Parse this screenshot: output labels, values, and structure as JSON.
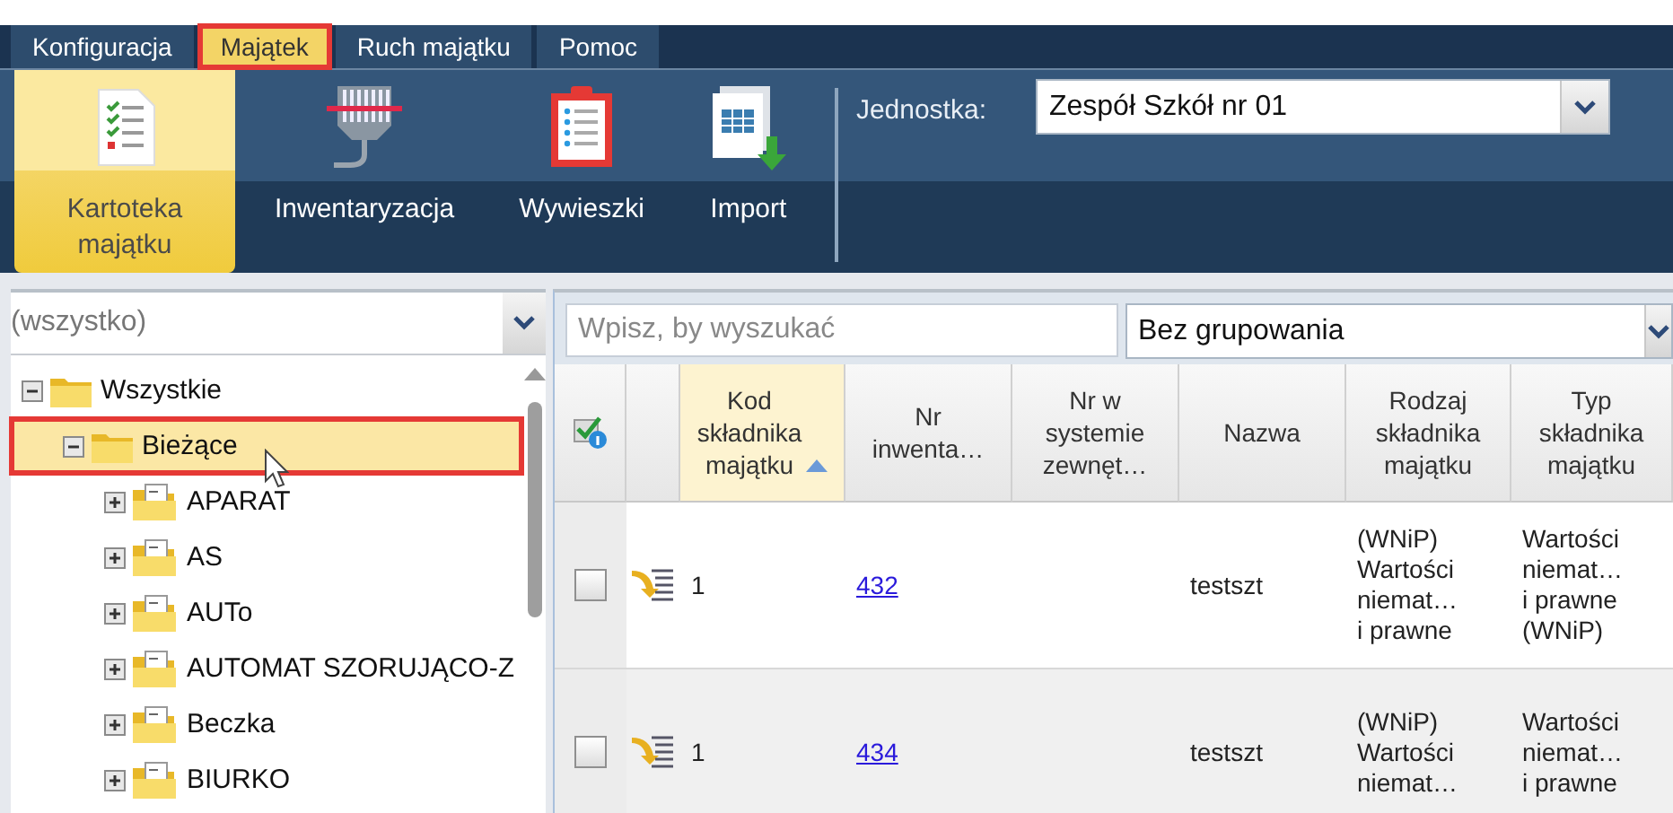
{
  "menu": {
    "tabs": [
      {
        "label": "Konfiguracja",
        "selected": false,
        "highlighted": false
      },
      {
        "label": "Majątek",
        "selected": true,
        "highlighted": true
      },
      {
        "label": "Ruch majątku",
        "selected": false,
        "highlighted": false
      },
      {
        "label": "Pomoc",
        "selected": false,
        "highlighted": false
      }
    ]
  },
  "ribbon": {
    "buttons": [
      {
        "label": "Kartoteka majątku",
        "selected": true
      },
      {
        "label": "Inwentaryzacja",
        "selected": false
      },
      {
        "label": "Wywieszki",
        "selected": false
      },
      {
        "label": "Import",
        "selected": false
      }
    ],
    "unit": {
      "label": "Jednostka:",
      "value": "Zespół Szkół nr 01"
    }
  },
  "tree_panel": {
    "filter": {
      "placeholder": "(wszystko)"
    },
    "tree": [
      {
        "label": "Wszystkie",
        "expanded": true,
        "selected": false,
        "highlighted": false,
        "children": [
          {
            "label": "Bieżące",
            "expanded": true,
            "selected": true,
            "highlighted": true,
            "children": [
              {
                "label": "APARAT",
                "expanded": false,
                "selected": false,
                "highlighted": false
              },
              {
                "label": "AS",
                "expanded": false,
                "selected": false,
                "highlighted": false
              },
              {
                "label": "AUTo",
                "expanded": false,
                "selected": false,
                "highlighted": false
              },
              {
                "label": "AUTOMAT SZORUJĄCO-Z",
                "expanded": false,
                "selected": false,
                "highlighted": false
              },
              {
                "label": "Beczka",
                "expanded": false,
                "selected": false,
                "highlighted": false
              },
              {
                "label": "BIURKO",
                "expanded": false,
                "selected": false,
                "highlighted": false
              }
            ]
          }
        ]
      }
    ]
  },
  "grid": {
    "search": {
      "placeholder": "Wpisz, by wyszukać"
    },
    "grouping": {
      "value": "Bez grupowania"
    },
    "columns": [
      {
        "kind": "select",
        "sorted": false
      },
      {
        "kind": "action",
        "sorted": false
      },
      {
        "kind": "text",
        "label": "Kod\nskładnika\nmajątku",
        "sorted": true
      },
      {
        "kind": "link",
        "label": "Nr\ninwenta…",
        "sorted": false
      },
      {
        "kind": "text",
        "label": "Nr w\nsystemie\nzewnęt…",
        "sorted": false
      },
      {
        "kind": "text",
        "label": "Nazwa",
        "sorted": false
      },
      {
        "kind": "text",
        "label": "Rodzaj\nskładnika\nmajątku",
        "sorted": false
      },
      {
        "kind": "text",
        "label": "Typ\nskładnika\nmajątku",
        "sorted": false
      }
    ],
    "rows": [
      {
        "checked": false,
        "cells": [
          "1",
          "432",
          null,
          "testszt",
          "(WNiP)\nWartości\nniemat…\ni prawne",
          "Wartości\nniemat…\ni prawne\n(WNiP)"
        ]
      },
      {
        "checked": false,
        "cells": [
          "1",
          "434",
          null,
          "testszt",
          "(WNiP)\nWartości\nniemat…",
          "Wartości\nniemat…\ni prawne"
        ]
      }
    ]
  }
}
